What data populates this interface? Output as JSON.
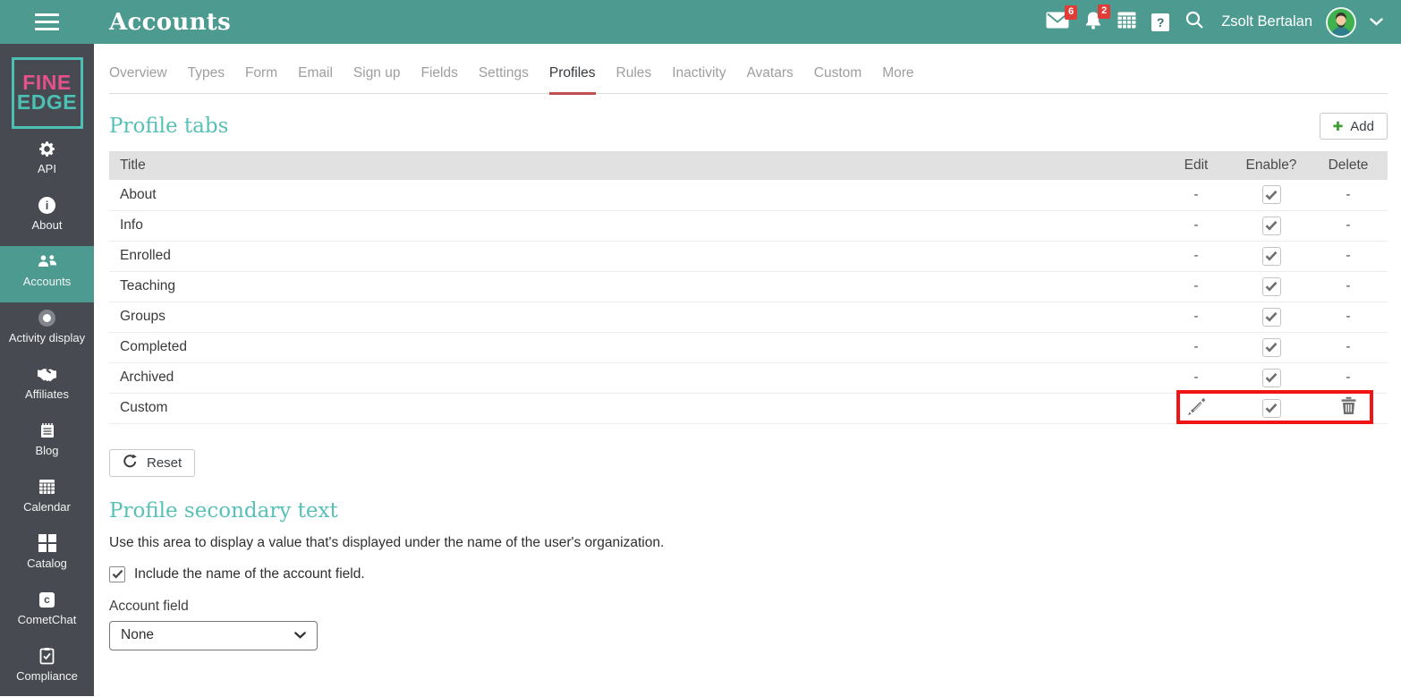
{
  "colors": {
    "header_teal": "#4D9B90",
    "sidebar_dark": "#474B51",
    "heading_teal": "#57C1B6",
    "tab_underline_red": "#C0504D",
    "badge_red": "#E23C39",
    "annotation_red": "#F01414",
    "add_plus_green": "#3F9C35",
    "logo_pink": "#E5518B",
    "logo_teal": "#4CC0B4"
  },
  "header": {
    "title": "Accounts",
    "user_name": "Zsolt Bertalan",
    "messages_badge": "6",
    "notifications_badge": "2",
    "icons": [
      "envelope-icon",
      "bell-icon",
      "table-grid-icon",
      "help-icon",
      "search-icon",
      "avatar",
      "chevron-down-icon"
    ]
  },
  "sidebar": {
    "logo_line1": "FINE",
    "logo_line2": "EDGE",
    "items": [
      {
        "label": "API",
        "icon": "gear-icon"
      },
      {
        "label": "About",
        "icon": "info-icon"
      },
      {
        "label": "Accounts",
        "icon": "people-icon",
        "active": true
      },
      {
        "label": "Activity display",
        "icon": "dot-circle-icon"
      },
      {
        "label": "Affiliates",
        "icon": "handshake-icon"
      },
      {
        "label": "Blog",
        "icon": "notepad-icon"
      },
      {
        "label": "Calendar",
        "icon": "calendar-icon"
      },
      {
        "label": "Catalog",
        "icon": "squares-icon"
      },
      {
        "label": "CometChat",
        "icon": "cometchat-icon"
      },
      {
        "label": "Compliance",
        "icon": "clipboard-check-icon"
      }
    ]
  },
  "tabs": {
    "items": [
      "Overview",
      "Types",
      "Form",
      "Email",
      "Sign up",
      "Fields",
      "Settings",
      "Profiles",
      "Rules",
      "Inactivity",
      "Avatars",
      "Custom",
      "More"
    ],
    "active": "Profiles"
  },
  "profile_tabs": {
    "heading": "Profile tabs",
    "add_label": "Add",
    "columns": [
      "Title",
      "Edit",
      "Enable?",
      "Delete"
    ],
    "rows": [
      {
        "title": "About",
        "edit": "-",
        "enabled": true,
        "delete": "-"
      },
      {
        "title": "Info",
        "edit": "-",
        "enabled": true,
        "delete": "-"
      },
      {
        "title": "Enrolled",
        "edit": "-",
        "enabled": true,
        "delete": "-"
      },
      {
        "title": "Teaching",
        "edit": "-",
        "enabled": true,
        "delete": "-"
      },
      {
        "title": "Groups",
        "edit": "-",
        "enabled": true,
        "delete": "-"
      },
      {
        "title": "Completed",
        "edit": "-",
        "enabled": true,
        "delete": "-"
      },
      {
        "title": "Archived",
        "edit": "-",
        "enabled": true,
        "delete": "-"
      },
      {
        "title": "Custom",
        "edit": "pencil-icon",
        "enabled": true,
        "delete": "trash-icon",
        "highlighted": true
      }
    ],
    "reset_label": "Reset"
  },
  "secondary": {
    "heading": "Profile secondary text",
    "description": "Use this area to display a value that's displayed under the name of the user's organization.",
    "checkbox_label": "Include the name of the account field.",
    "checkbox_checked": true,
    "field_label": "Account field",
    "field_value": "None"
  }
}
